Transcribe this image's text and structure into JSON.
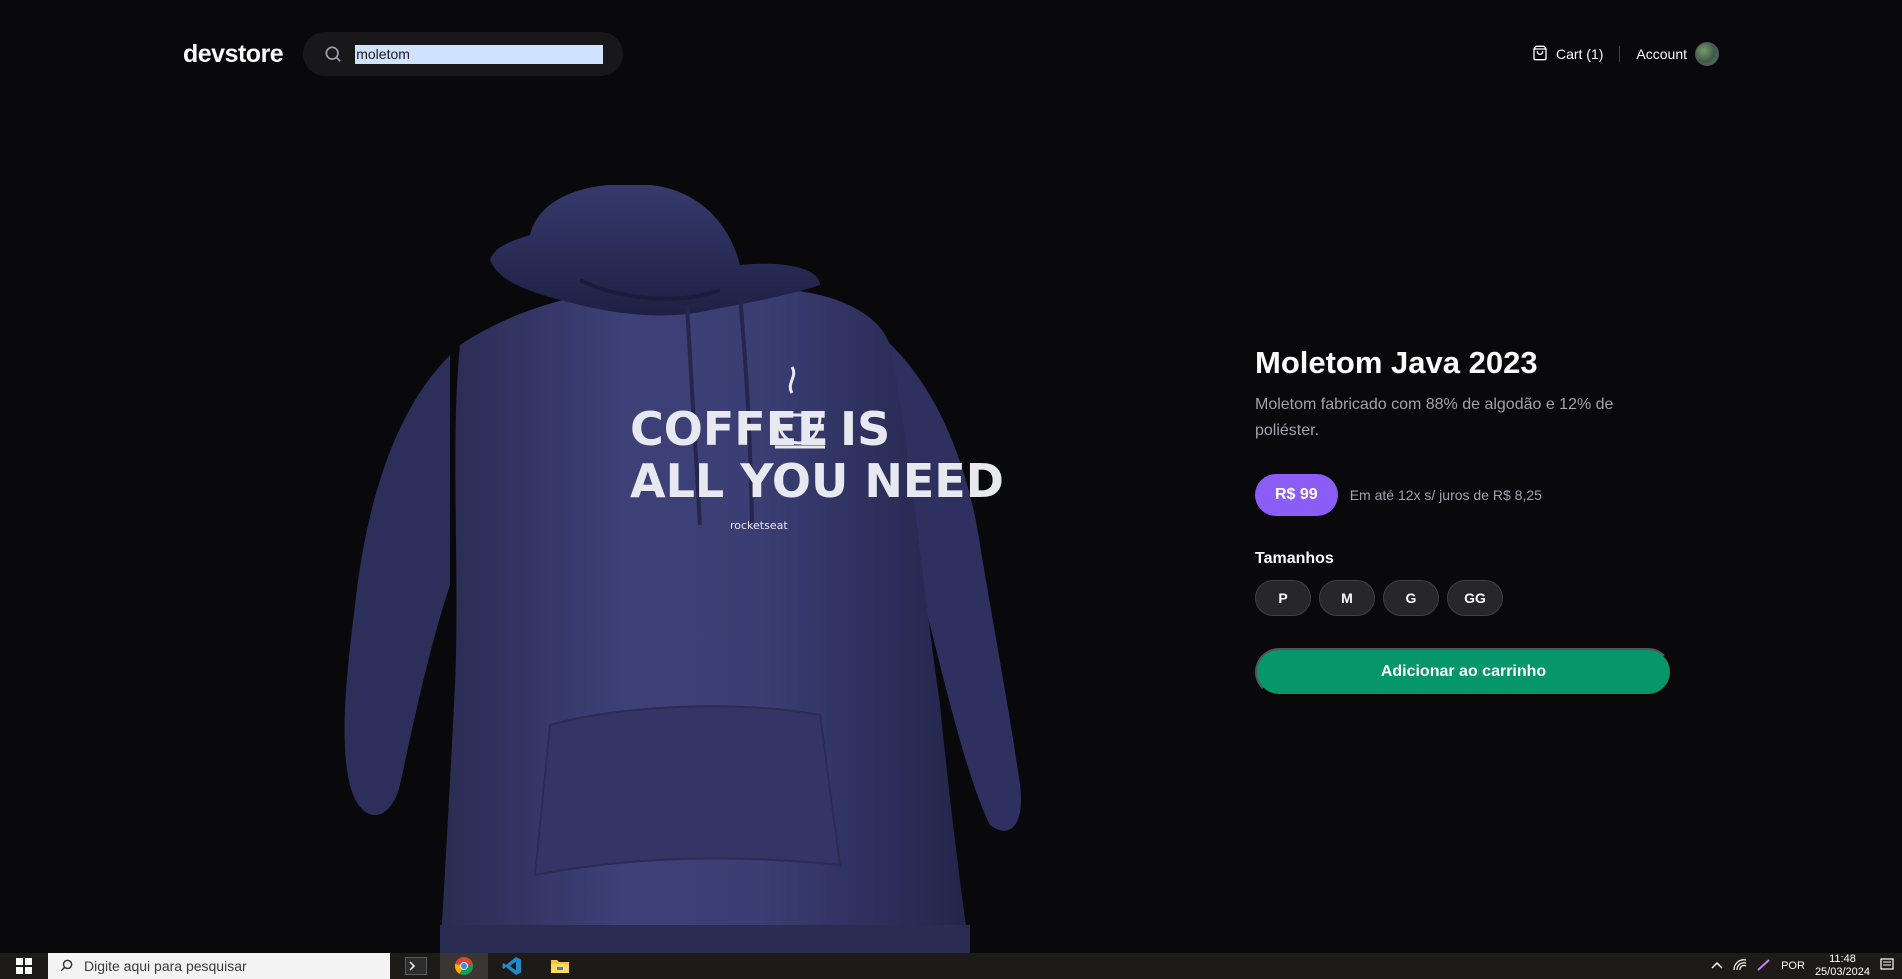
{
  "header": {
    "logo": "devstore",
    "search": {
      "value": "moletom",
      "placeholder": ""
    },
    "cart_label": "Cart (1)",
    "account_label": "Account"
  },
  "product": {
    "image_alt": "Moletom Java 2023",
    "print_line1": "COFFEE",
    "print_line1b": "IS",
    "print_line2": "ALL YOU NEED",
    "print_brand": "rocketseat",
    "title": "Moletom Java 2023",
    "description": "Moletom fabricado com 88% de algodão e 12% de poliéster.",
    "price": "R$ 99",
    "installments": "Em até 12x s/ juros de R$ 8,25",
    "sizes_label": "Tamanhos",
    "sizes": [
      "P",
      "M",
      "G",
      "GG"
    ],
    "add_to_cart": "Adicionar ao carrinho"
  },
  "colors": {
    "background": "#09090b",
    "price_badge": "#8b5cf6",
    "add_button": "#059669",
    "hoodie": "#3a3d6e"
  },
  "taskbar": {
    "search_placeholder": "Digite aqui para pesquisar",
    "language": "POR",
    "time": "11:48",
    "date": "25/03/2024",
    "apps": [
      "terminal-icon",
      "chrome-icon",
      "vscode-icon",
      "file-explorer-icon"
    ]
  }
}
